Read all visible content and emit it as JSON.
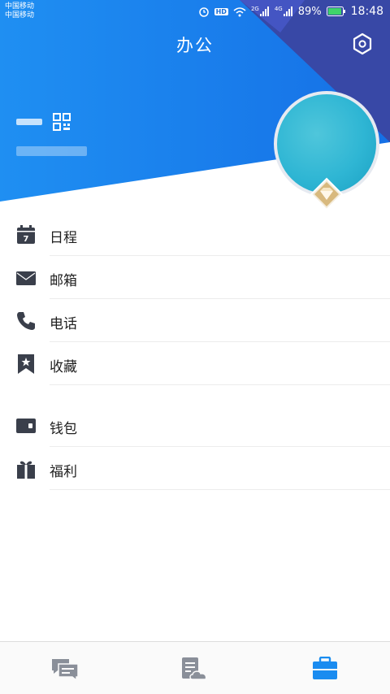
{
  "status_bar": {
    "carrier_line1": "中国移动",
    "carrier_line2": "中国移动",
    "hd_label": "HD",
    "net1_label": "2G",
    "net2_label": "4G",
    "battery": "89%",
    "time": "18:48"
  },
  "header": {
    "title": "办公",
    "settings_icon": "hexagon-settings-icon",
    "qr_icon": "qr-code-icon"
  },
  "menu": {
    "group1": [
      {
        "label": "日程",
        "icon": "calendar-icon"
      },
      {
        "label": "邮箱",
        "icon": "mail-icon"
      },
      {
        "label": "电话",
        "icon": "phone-icon"
      },
      {
        "label": "收藏",
        "icon": "bookmark-star-icon"
      }
    ],
    "group2": [
      {
        "label": "钱包",
        "icon": "wallet-icon"
      },
      {
        "label": "福利",
        "icon": "gift-icon"
      }
    ]
  },
  "calendar_day": "7",
  "bottom_nav": [
    {
      "name": "messages",
      "icon": "chat-bubbles-icon",
      "active": false
    },
    {
      "name": "cloud-docs",
      "icon": "cloud-document-icon",
      "active": false
    },
    {
      "name": "work",
      "icon": "briefcase-icon",
      "active": true
    }
  ],
  "colors": {
    "header_blue": "#1a88f0",
    "header_dark": "#3a4aa8",
    "icon_dark": "#3a3f4b",
    "active_tab": "#1a8cf0",
    "inactive_tab": "#8a8f99",
    "badge_gold": "#c9a66b"
  }
}
